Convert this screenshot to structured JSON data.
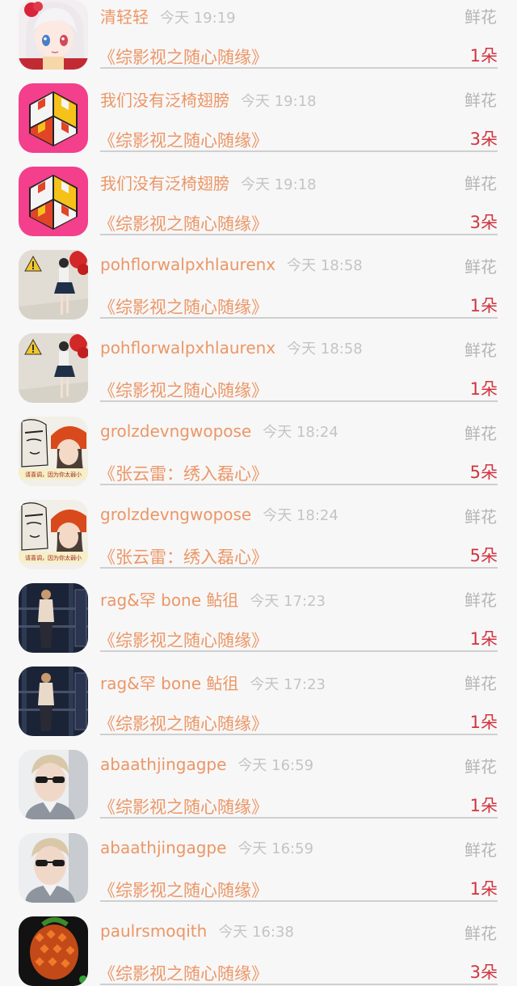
{
  "rows": [
    {
      "user": "清轻轻",
      "time": "今天 19:19",
      "gift": "鲜花",
      "work": "《综影视之随心随缘》",
      "count": "1朵",
      "avatar": "anime-avatar"
    },
    {
      "user": "我们没有泛椅翅膀",
      "time": "今天 19:18",
      "gift": "鲜花",
      "work": "《综影视之随心随缘》",
      "count": "3朵",
      "avatar": "cube-avatar"
    },
    {
      "user": "我们没有泛椅翅膀",
      "time": "今天 19:18",
      "gift": "鲜花",
      "work": "《综影视之随心随缘》",
      "count": "3朵",
      "avatar": "cube-avatar"
    },
    {
      "user": "pohflorwalpxhlaurenx",
      "time": "今天 18:58",
      "gift": "鲜花",
      "work": "《综影视之随心随缘》",
      "count": "1朵",
      "avatar": "wall-avatar"
    },
    {
      "user": "pohflorwalpxhlaurenx",
      "time": "今天 18:58",
      "gift": "鲜花",
      "work": "《综影视之随心随缘》",
      "count": "1朵",
      "avatar": "wall-avatar"
    },
    {
      "user": "grolzdevngwopose",
      "time": "今天 18:24",
      "gift": "鲜花",
      "work": "《张云雷：绣入磊心》",
      "count": "5朵",
      "avatar": "comic-avatar"
    },
    {
      "user": "grolzdevngwopose",
      "time": "今天 18:24",
      "gift": "鲜花",
      "work": "《张云雷：绣入磊心》",
      "count": "5朵",
      "avatar": "comic-avatar"
    },
    {
      "user": "rag&罕 bone 鲇徂",
      "time": "今天 17:23",
      "gift": "鲜花",
      "work": "《综影视之随心随缘》",
      "count": "1朵",
      "avatar": "gym-avatar"
    },
    {
      "user": "rag&罕 bone 鲇徂",
      "time": "今天 17:23",
      "gift": "鲜花",
      "work": "《综影视之随心随缘》",
      "count": "1朵",
      "avatar": "gym-avatar"
    },
    {
      "user": "abaathjingagpe",
      "time": "今天 16:59",
      "gift": "鲜花",
      "work": "《综影视之随心随缘》",
      "count": "1朵",
      "avatar": "sunglasses-avatar"
    },
    {
      "user": "abaathjingagpe",
      "time": "今天 16:59",
      "gift": "鲜花",
      "work": "《综影视之随心随缘》",
      "count": "1朵",
      "avatar": "sunglasses-avatar"
    },
    {
      "user": "paulrsmoqith",
      "time": "今天 16:38",
      "gift": "鲜花",
      "work": "《综影视之随心随缘》",
      "count": "3朵",
      "avatar": "fruit-avatar"
    }
  ],
  "comic_avatar_caption": "请喜调，因为你太弱小"
}
